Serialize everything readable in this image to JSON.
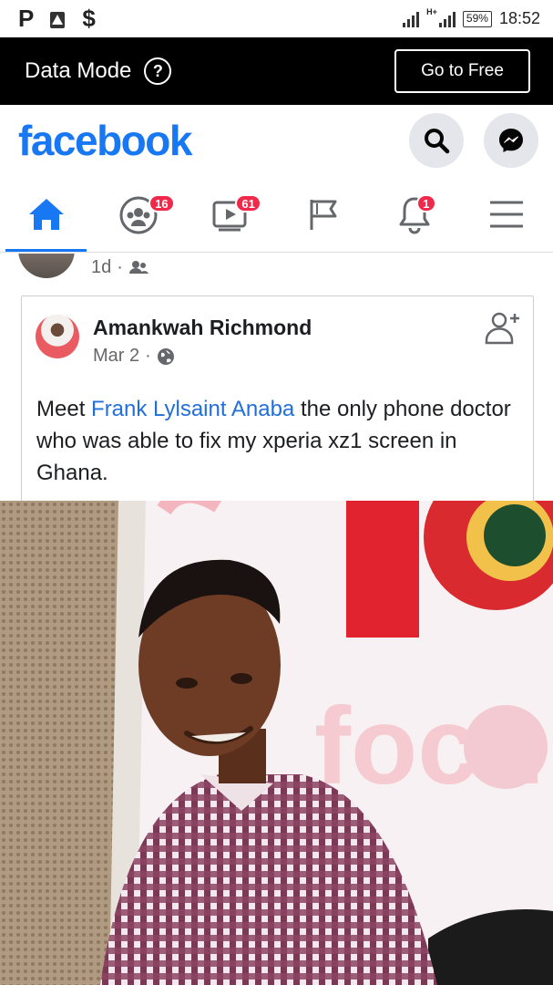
{
  "status_bar": {
    "battery": "59%",
    "time": "18:52",
    "network": "H+"
  },
  "data_mode": {
    "label": "Data Mode",
    "help": "?",
    "go_free_label": "Go to Free"
  },
  "header": {
    "logo": "facebook"
  },
  "tabs": {
    "friends_badge": "16",
    "watch_badge": "61",
    "notifications_badge": "1"
  },
  "previous_post": {
    "time": "1d"
  },
  "post": {
    "author": "Amankwah Richmond",
    "date": "Mar 2",
    "text_before": "Meet ",
    "mention": "Frank Lylsaint Anaba",
    "text_after": "  the only phone doctor who was able to fix my xperia xz1 screen in Ghana."
  },
  "colors": {
    "brand": "#1877f2",
    "badge": "#f02849",
    "data_bar": "#000000"
  }
}
